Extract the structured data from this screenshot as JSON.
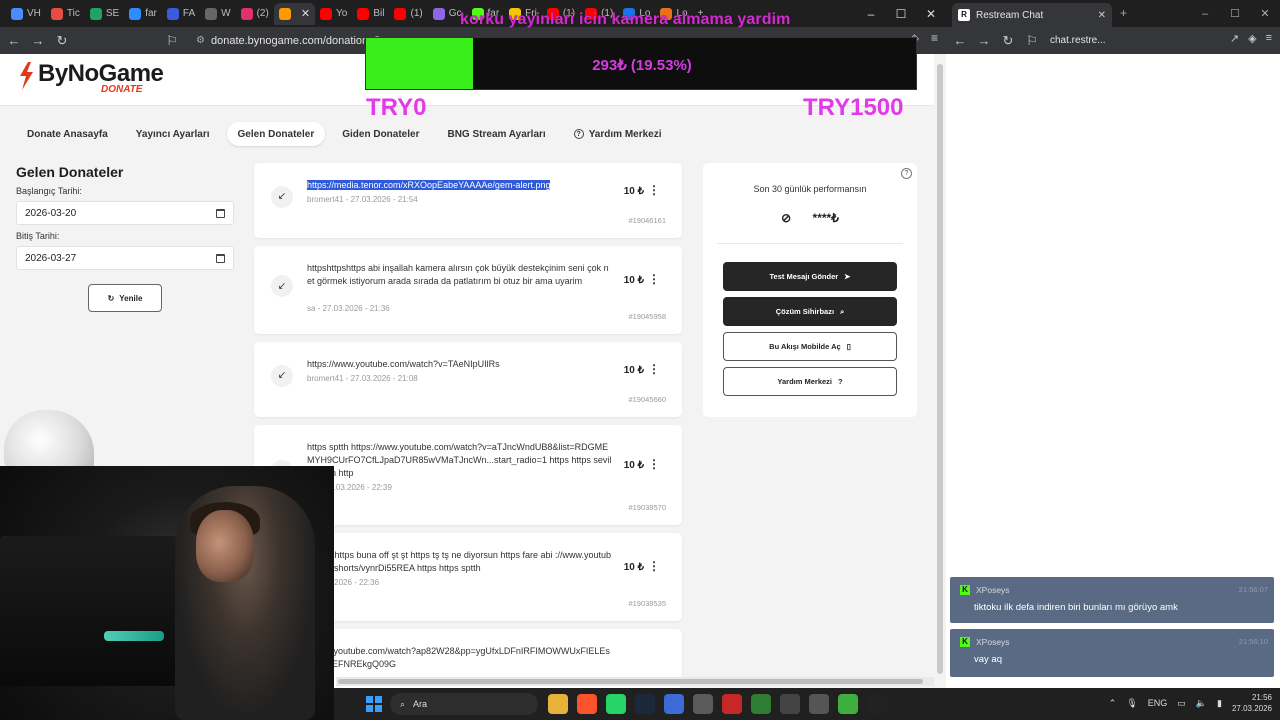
{
  "browser": {
    "tabs": [
      {
        "label": "VH",
        "color": "#4a8cff"
      },
      {
        "label": "Tic",
        "color": "#e54d42"
      },
      {
        "label": "SE",
        "color": "#1fa463"
      },
      {
        "label": "far",
        "color": "#2d8cff"
      },
      {
        "label": "FA",
        "color": "#3b5bdb"
      },
      {
        "label": "W",
        "color": "#666666"
      },
      {
        "label": "(2)",
        "color": "#e1306c"
      },
      {
        "label": "",
        "color": "#ff9900",
        "active": true
      },
      {
        "label": "Yo",
        "color": "#ff0000"
      },
      {
        "label": "Bil",
        "color": "#ff0000"
      },
      {
        "label": "(1)",
        "color": "#ff0000"
      },
      {
        "label": "Gc",
        "color": "#8e67e6"
      },
      {
        "label": "far",
        "color": "#53fc18"
      },
      {
        "label": "Fri",
        "color": "#f7c600"
      },
      {
        "label": "(1)",
        "color": "#ff0000"
      },
      {
        "label": "(1)",
        "color": "#ff0000"
      },
      {
        "label": "Lo",
        "color": "#1a73e8"
      },
      {
        "label": "Lo",
        "color": "#e8711a"
      }
    ],
    "url": "donate.bynogame.com/donations/incom"
  },
  "site": {
    "logo_name": "ByNoGame",
    "logo_sub": "DONATE",
    "nav": [
      {
        "label": "Donate Anasayfa",
        "active": false
      },
      {
        "label": "Yayıncı Ayarları",
        "active": false
      },
      {
        "label": "Gelen Donateler",
        "active": true
      },
      {
        "label": "Giden Donateler",
        "active": false
      },
      {
        "label": "BNG Stream Ayarları",
        "active": false
      },
      {
        "label": "Yardım Merkezi",
        "active": false,
        "icon": "?"
      }
    ]
  },
  "filters": {
    "title": "Gelen Donateler",
    "start_label": "Başlangıç Tarihi:",
    "start_value": "2026-03-20",
    "end_label": "Bitiş Tarihi:",
    "end_value": "2026-03-27",
    "refresh_label": "Yenile"
  },
  "donations": [
    {
      "message": "https://media.tenor.com/xRXOopEabeYAAAAe/gem-alert.png",
      "meta": "bromert41 - 27.03.2026 - 21:54",
      "amount": "10 ₺",
      "id": "#19046161",
      "selected": true
    },
    {
      "message": "httpshttpshttps abi inşallah kamera alırsın çok büyük destekçinim seni çok net görmek istiyorum arada sırada da patlatırım bi otuz bir ama uyarim",
      "meta": "sa - 27.03.2026 - 21:36",
      "amount": "10 ₺",
      "id": "#19045958"
    },
    {
      "message": "https://www.youtube.com/watch?v=TAeNIpUIlRs",
      "meta": "bromert41 - 27.03.2026 - 21:08",
      "amount": "10 ₺",
      "id": "#19045660"
    },
    {
      "message": "https sptth https://www.youtube.com/watch?v=aTJncWndUB8&list=RDGMEMYH9CUrFO7CfLJpaD7UR85wVMaTJncWn...start_radio=1 https https seviliyorsun http",
      "meta": "abi - 26.03.2026 - 22:39",
      "amount": "10 ₺",
      "id": "#19038570"
    },
    {
      "message": "yorum https buna off şt şt https tş tş ne diyorsun https fare abi ://www.youtube.com/shorts/vynrDi55REA https https sptth",
      "meta": "- 26.03.2026 - 22:36",
      "amount": "10 ₺",
      "id": "#19038535"
    },
    {
      "message": "//www.youtube.com/watch?ap82W28&pp=ygUfxLDFnIRFIMOWWUxFIELEsCBBREFNREkgQ09G",
      "meta": "",
      "amount": "",
      "id": ""
    }
  ],
  "performance": {
    "title": "Son 30 günlük performansın",
    "value": "****₺",
    "buttons": [
      {
        "label": "Test Mesajı Gönder",
        "style": "dark",
        "icon": "➤"
      },
      {
        "label": "Çözüm Sihirbazı",
        "style": "dark",
        "icon": "⌕"
      },
      {
        "label": "Bu Akışı Mobilde Aç",
        "style": "light",
        "icon": "▯"
      },
      {
        "label": "Yardım Merkezi",
        "style": "light",
        "icon": "?"
      }
    ]
  },
  "overlay": {
    "title": "korku yayinlari icin kamera almama yardim",
    "goal_text": "293₺ (19.53%)",
    "goal_progress": 0.1953,
    "goal_min": "TRY0",
    "goal_max": "TRY1500",
    "fill_color": "#39ee1b",
    "text_color": "#e23ae8"
  },
  "restream": {
    "tab_title": "Restream Chat",
    "url": "chat.restre...",
    "messages": [
      {
        "user": "XPoseys",
        "time": "21:56:07",
        "text": "tiktoku ilk defa indiren biri bunları mı görüyo amk"
      },
      {
        "user": "XPoseys",
        "time": "21:56:10",
        "text": "vay aq"
      }
    ]
  },
  "taskbar": {
    "search_placeholder": "Ara",
    "lang": "ENG",
    "time": "21:56",
    "date": "27.03.2026"
  }
}
